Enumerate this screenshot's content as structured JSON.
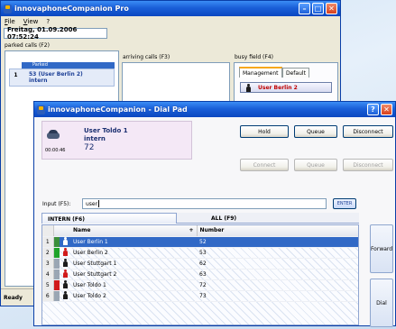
{
  "back_window": {
    "title": "innovaphoneCompanion Pro",
    "menu": [
      "File",
      "View",
      "?"
    ],
    "datetime": "Freitag, 01.09.2006 07:52:24",
    "parked": {
      "label": "parked calls (F2)",
      "header": "Parked",
      "row_index": "1",
      "row_line1": "53 (User Berlin 2)",
      "row_line2": "intern"
    },
    "arriving": {
      "label": "arriving calls (F3)"
    },
    "busy": {
      "label": "busy field (F4)",
      "tabs": [
        "Management",
        "Default"
      ],
      "active_item": "User Berlin 2"
    },
    "status_left": "Ready"
  },
  "dial_pad": {
    "title": "innovaphoneCompanion - Dial Pad",
    "call": {
      "name": "User Toldo 1",
      "type": "intern",
      "number": "72",
      "duration": "00:00:46"
    },
    "buttons_top": [
      "Hold",
      "Queue",
      "Disconnect"
    ],
    "buttons_bottom": [
      "Connect",
      "Queue",
      "Disconnect"
    ],
    "input": {
      "label": "Input (F5):",
      "value": "user",
      "enter": "ENTER"
    },
    "tabs": {
      "intern": "INTERN (F6)",
      "all": "ALL (F9)"
    },
    "columns": {
      "name": "Name",
      "number": "Number"
    },
    "rows": [
      {
        "idx": "1",
        "name": "User Berlin 1",
        "number": "52",
        "status": "#3b8f3b",
        "icon_color": "#1c1c1c",
        "selected": true
      },
      {
        "idx": "2",
        "name": "User Berlin 2",
        "number": "53",
        "status": "#1fa32a",
        "icon_color": "#d11a1a",
        "selected": false
      },
      {
        "idx": "3",
        "name": "User Stuttgart 1",
        "number": "62",
        "status": "#9aa6b4",
        "icon_color": "#1c1c1c",
        "selected": false
      },
      {
        "idx": "4",
        "name": "User Stuttgart 2",
        "number": "63",
        "status": "#9aa6b4",
        "icon_color": "#d11a1a",
        "selected": false
      },
      {
        "idx": "5",
        "name": "User Toldo 1",
        "number": "72",
        "status": "#d11a1a",
        "icon_color": "#1c1c1c",
        "selected": false
      },
      {
        "idx": "6",
        "name": "User Toldo 2",
        "number": "73",
        "status": "#9aa6b4",
        "icon_color": "#1c1c1c",
        "selected": false
      }
    ],
    "side_buttons": [
      "Forward",
      "Dial"
    ]
  },
  "colors": {
    "title_blue": "#0b47c0",
    "selection": "#3169c6",
    "busy_red": "#c00000",
    "call_panel": "#f4e8f6"
  }
}
